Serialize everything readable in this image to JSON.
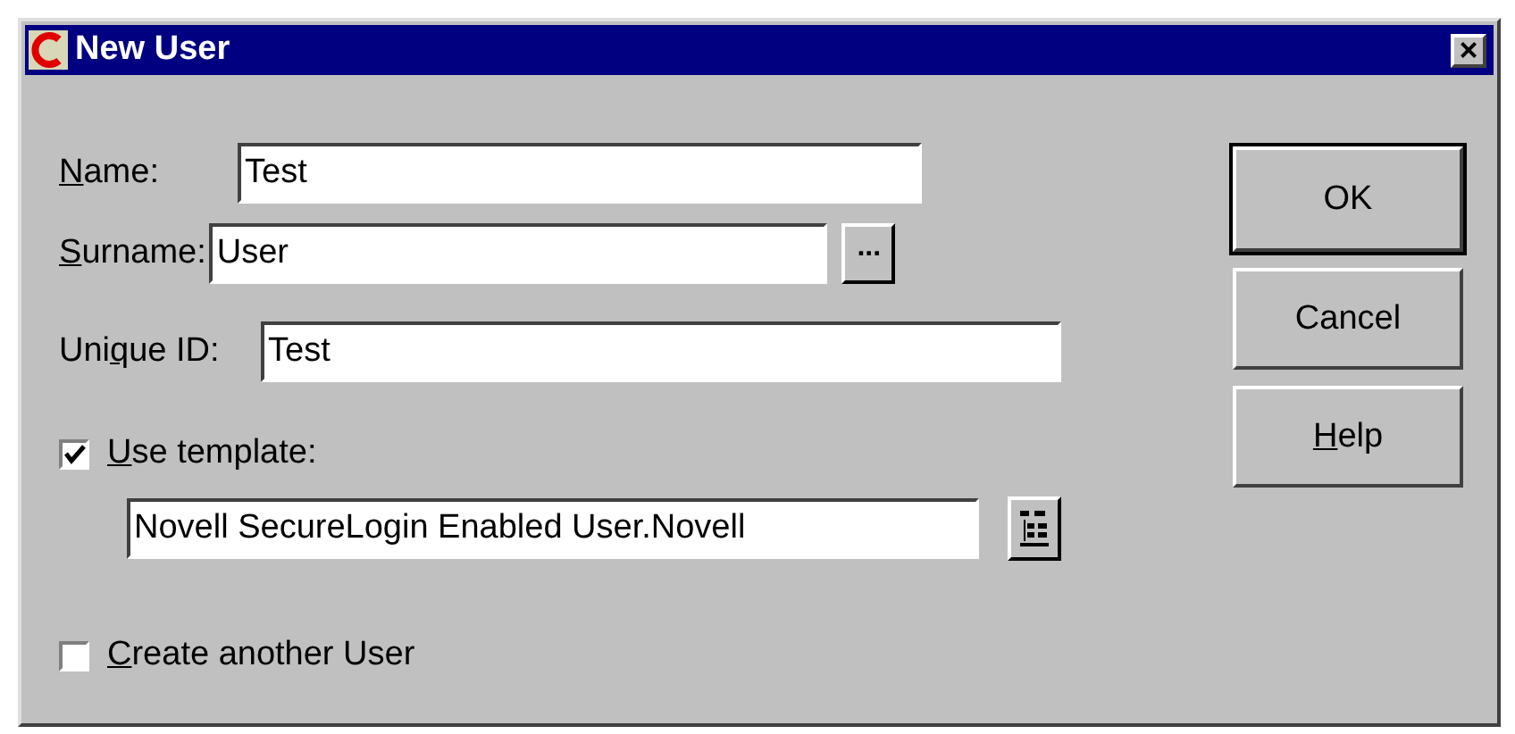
{
  "window": {
    "title": "New User",
    "close": "×"
  },
  "fields": [
    {
      "label": [
        {
          "text": "N",
          "underlined": true
        },
        {
          "text": "ame:",
          "underlined": false
        }
      ],
      "value": "Test"
    },
    {
      "label": [
        {
          "text": "S",
          "underlined": true
        },
        {
          "text": "urname:",
          "underlined": false
        }
      ],
      "value": "User",
      "button": "..."
    },
    {
      "label": [
        {
          "text": "Uni",
          "underlined": false
        },
        {
          "text": "q",
          "underlined": true
        },
        {
          "text": "ue ID:",
          "underlined": false
        }
      ],
      "value": "Test"
    }
  ],
  "use_template": {
    "label": [
      {
        "text": "U",
        "underlined": true
      },
      {
        "text": "se template:",
        "underlined": false
      }
    ],
    "checked": true,
    "value": "Novell SecureLogin Enabled User.Novell"
  },
  "create_another": {
    "label": [
      {
        "text": "C",
        "underlined": true
      },
      {
        "text": "reate another User",
        "underlined": false
      }
    ],
    "checked": false
  },
  "buttons": [
    {
      "label": [
        {
          "text": "OK",
          "underlined": false
        }
      ],
      "default": true
    },
    {
      "label": [
        {
          "text": "Cancel",
          "underlined": false
        }
      ],
      "default": false
    },
    {
      "label": [
        {
          "text": "H",
          "underlined": true
        },
        {
          "text": "elp",
          "underlined": false
        }
      ],
      "default": false
    }
  ]
}
